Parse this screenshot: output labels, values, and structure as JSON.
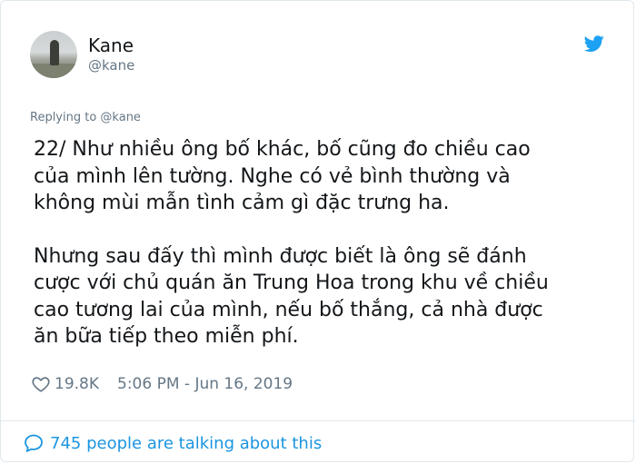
{
  "user": {
    "display_name": "Kane",
    "handle": "@kane"
  },
  "reply": {
    "text": "Replying to @kane"
  },
  "tweet": {
    "paragraph1": "22/ Như nhiều ông bố khác, bố cũng đo chiều cao\ncủa mình lên tường. Nghe có vẻ bình thường và\nkhông mùi mẫn tình cảm gì đặc trưng ha.",
    "paragraph2": "Nhưng sau đấy thì mình được biết là ông sẽ đánh\ncược với chủ quán ăn Trung Hoa trong khu về chiều\ncao tương lai của mình, nếu bố thắng, cả nhà được\năn bữa tiếp theo miễn phí."
  },
  "meta": {
    "likes": "19.8K",
    "timestamp": "5:06 PM - Jun 16, 2019"
  },
  "footer": {
    "talking": "745 people are talking about this"
  },
  "icons": {
    "brand": "twitter-bird-icon",
    "like": "heart-icon",
    "conversation": "speech-bubble-icon"
  },
  "colors": {
    "brand_blue": "#1da1f2",
    "link_blue": "#1b95e0",
    "muted_gray": "#657786",
    "text": "#14171a"
  }
}
